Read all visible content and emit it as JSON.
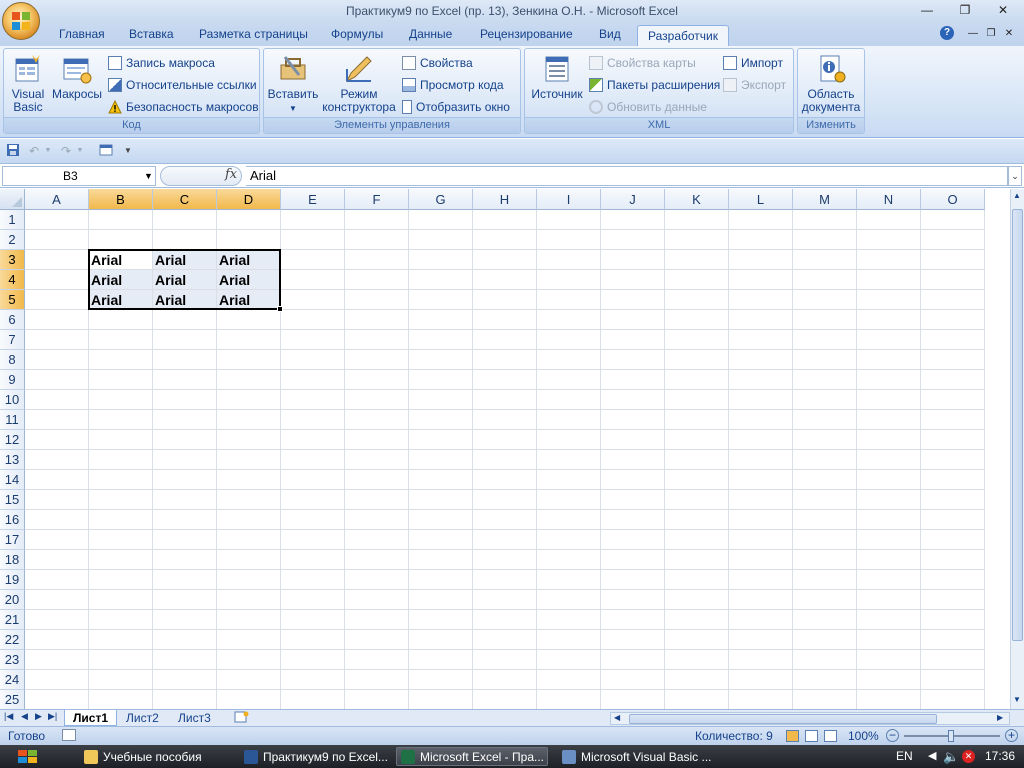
{
  "window": {
    "title": "Практикум9 по Excel (пр. 13), Зенкина О.Н. - Microsoft Excel",
    "min_glyph": "—",
    "restore_glyph": "❐",
    "close_glyph": "✕"
  },
  "tabs": [
    "Главная",
    "Вставка",
    "Разметка страницы",
    "Формулы",
    "Данные",
    "Рецензирование",
    "Вид",
    "Разработчик"
  ],
  "active_tab": "Разработчик",
  "ribbon": {
    "code": {
      "label": "Код",
      "visual_basic": [
        "Visual",
        "Basic"
      ],
      "macros": "Макросы",
      "record_macro": "Запись макроса",
      "relative_refs": "Относительные ссылки",
      "macro_security": "Безопасность макросов"
    },
    "controls": {
      "label": "Элементы управления",
      "insert": "Вставить",
      "design_mode": [
        "Режим",
        "конструктора"
      ],
      "properties": "Свойства",
      "view_code": "Просмотр кода",
      "show_window": "Отобразить окно"
    },
    "xml": {
      "label": "XML",
      "source": "Источник",
      "map_properties": "Свойства карты",
      "expansion_packs": "Пакеты расширения",
      "refresh_data": "Обновить данные",
      "import": "Импорт",
      "export": "Экспорт"
    },
    "modify": {
      "label": "Изменить",
      "document_panel": [
        "Область",
        "документа"
      ]
    }
  },
  "formula_bar": {
    "name_box": "B3",
    "fx": "fx",
    "value": "Arial"
  },
  "grid": {
    "columns": [
      "A",
      "B",
      "C",
      "D",
      "E",
      "F",
      "G",
      "H",
      "I",
      "J",
      "K",
      "L",
      "M",
      "N",
      "O"
    ],
    "rows": [
      "1",
      "2",
      "3",
      "4",
      "5",
      "6",
      "7",
      "8",
      "9",
      "10",
      "11",
      "12",
      "13",
      "14",
      "15",
      "16",
      "17",
      "18",
      "19",
      "20",
      "21",
      "22",
      "23",
      "24",
      "25"
    ],
    "selected_columns": [
      "B",
      "C",
      "D"
    ],
    "selected_rows": [
      "3",
      "4",
      "5"
    ],
    "cells": [
      {
        "col": "B",
        "row": "3",
        "value": "Arial"
      },
      {
        "col": "C",
        "row": "3",
        "value": "Arial"
      },
      {
        "col": "D",
        "row": "3",
        "value": "Arial"
      },
      {
        "col": "B",
        "row": "4",
        "value": "Arial"
      },
      {
        "col": "C",
        "row": "4",
        "value": "Arial"
      },
      {
        "col": "D",
        "row": "4",
        "value": "Arial"
      },
      {
        "col": "B",
        "row": "5",
        "value": "Arial"
      },
      {
        "col": "C",
        "row": "5",
        "value": "Arial"
      },
      {
        "col": "D",
        "row": "5",
        "value": "Arial"
      }
    ]
  },
  "sheets": [
    "Лист1",
    "Лист2",
    "Лист3"
  ],
  "active_sheet": "Лист1",
  "status": {
    "ready": "Готово",
    "count": "Количество: 9",
    "zoom": "100%"
  },
  "taskbar": {
    "items": [
      "Учебные пособия",
      "Практикум9 по Excel...",
      "Microsoft Excel - Пра...",
      "Microsoft Visual Basic ..."
    ],
    "active_index": 2,
    "lang": "EN",
    "clock": "17:36"
  },
  "colors": {
    "selection_header": "#f1b94b",
    "selection_fill": "#e6ecf6",
    "ribbon_text": "#15428b"
  }
}
